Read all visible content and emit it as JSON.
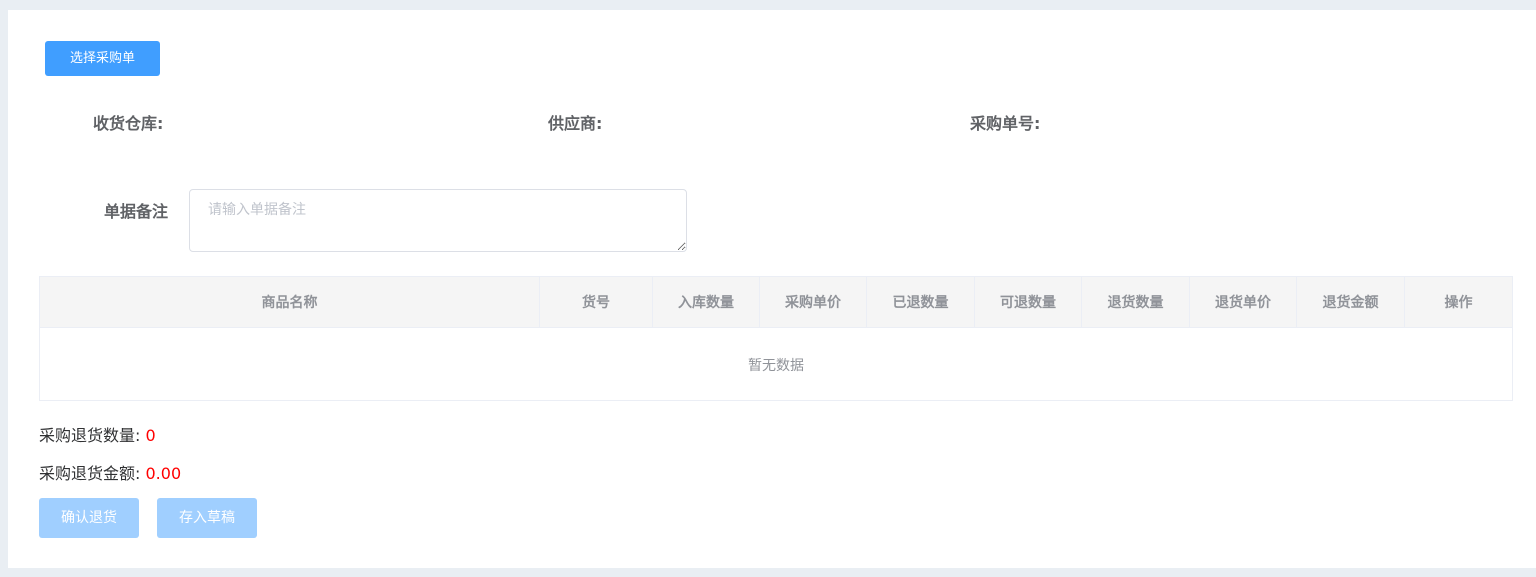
{
  "toolbar": {
    "select_order_label": "选择采购单"
  },
  "info": {
    "warehouse_label": "收货仓库:",
    "supplier_label": "供应商:",
    "order_no_label": "采购单号:"
  },
  "remark": {
    "label": "单据备注",
    "placeholder": "请输入单据备注",
    "value": ""
  },
  "table": {
    "columns": [
      "商品名称",
      "货号",
      "入库数量",
      "采购单价",
      "已退数量",
      "可退数量",
      "退货数量",
      "退货单价",
      "退货金额",
      "操作"
    ],
    "rows": [],
    "empty_text": "暂无数据"
  },
  "summary": {
    "qty_label": "采购退货数量:",
    "qty_value": "0",
    "amount_label": "采购退货金额:",
    "amount_value": "0.00"
  },
  "actions": {
    "confirm_label": "确认退货",
    "draft_label": "存入草稿"
  },
  "colors": {
    "primary": "#409eff",
    "primary_disabled": "#a0cfff",
    "value_red": "#ff0000",
    "page_bg": "#e9eef3"
  }
}
